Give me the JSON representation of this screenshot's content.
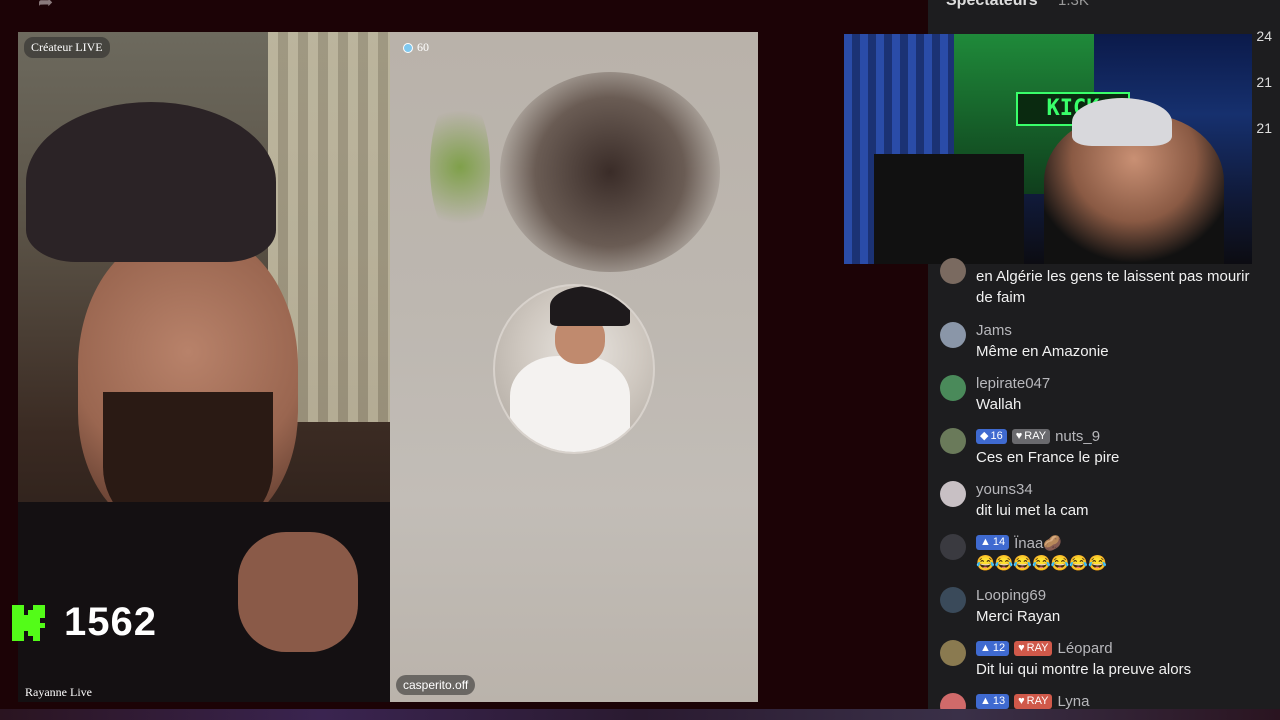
{
  "stage": {
    "left_label": "Créateur LIVE",
    "right_viewer_count": "60",
    "left_name": "Rayanne Live",
    "right_name": "casperito.off"
  },
  "kick_counter": {
    "value": "1562",
    "brand_color": "#53fc18"
  },
  "sidebar": {
    "title": "Spectateurs",
    "count": "1.3K",
    "right_numbers": [
      "24",
      "21",
      "21"
    ]
  },
  "chat": {
    "messages": [
      {
        "user": "",
        "text": "en Algérie les gens te laissent pas mourir de faim",
        "badges": []
      },
      {
        "user": "Jams",
        "text": "Même en Amazonie",
        "badges": []
      },
      {
        "user": "lepirate047",
        "text": "Wallah",
        "badges": []
      },
      {
        "user": "nuts_9",
        "text": "Ces en France le pire",
        "badges": [
          {
            "type": "lvl",
            "label": "16"
          },
          {
            "type": "ray",
            "label": "RAY"
          }
        ]
      },
      {
        "user": "youns34",
        "text": "dit lui met la cam",
        "badges": []
      },
      {
        "user": "Ïnaa🥔",
        "text": "😂😂😂😂😂😂😂",
        "badges": [
          {
            "type": "lvl",
            "label": "14"
          }
        ]
      },
      {
        "user": "Looping69",
        "text": "Merci Rayan",
        "badges": []
      },
      {
        "user": "Léopard",
        "text": "Dit lui qui montre la preuve alors",
        "badges": [
          {
            "type": "lvl",
            "label": "12"
          },
          {
            "type": "ray-hot",
            "label": "RAY"
          }
        ]
      },
      {
        "user": "Lyna",
        "text": "",
        "badges": [
          {
            "type": "lvl",
            "label": "13"
          },
          {
            "type": "ray-hot",
            "label": "RAY"
          }
        ]
      }
    ]
  },
  "webcam": {
    "sign_text": "KICK"
  },
  "icons": {
    "share": "share-icon",
    "viewer_dot": "live-dot-icon",
    "kick": "kick-logo-icon"
  }
}
